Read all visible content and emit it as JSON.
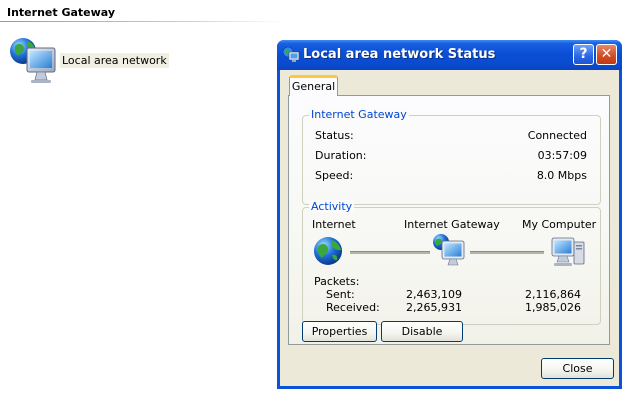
{
  "pane": {
    "header": "Internet Gateway",
    "item_label": "Local area network"
  },
  "dialog": {
    "title": "Local area network Status",
    "help_glyph": "?",
    "close_glyph": "✕",
    "tab": "General",
    "gateway_group": {
      "title": "Internet Gateway",
      "rows": [
        {
          "label": "Status:",
          "value": "Connected"
        },
        {
          "label": "Duration:",
          "value": "03:57:09"
        },
        {
          "label": "Speed:",
          "value": "8.0 Mbps"
        }
      ]
    },
    "activity_group": {
      "title": "Activity",
      "nodes": [
        "Internet",
        "Internet Gateway",
        "My Computer"
      ],
      "packets_label": "Packets:",
      "sent_label": "Sent:",
      "received_label": "Received:",
      "sent_left": "2,463,109",
      "sent_right": "2,116,864",
      "received_left": "2,265,931",
      "received_right": "1,985,026"
    },
    "buttons": {
      "properties": "Properties",
      "disable": "Disable",
      "close": "Close"
    }
  },
  "colors": {
    "title_blue": "#0a4fd6",
    "group_title": "#0046d5",
    "tab_highlight": "#ffc83c",
    "dialog_bg": "#ece9d8"
  },
  "icons": [
    "network-globe-icon",
    "connection-icon",
    "internet-globe-icon",
    "gateway-icon",
    "computer-icon"
  ]
}
